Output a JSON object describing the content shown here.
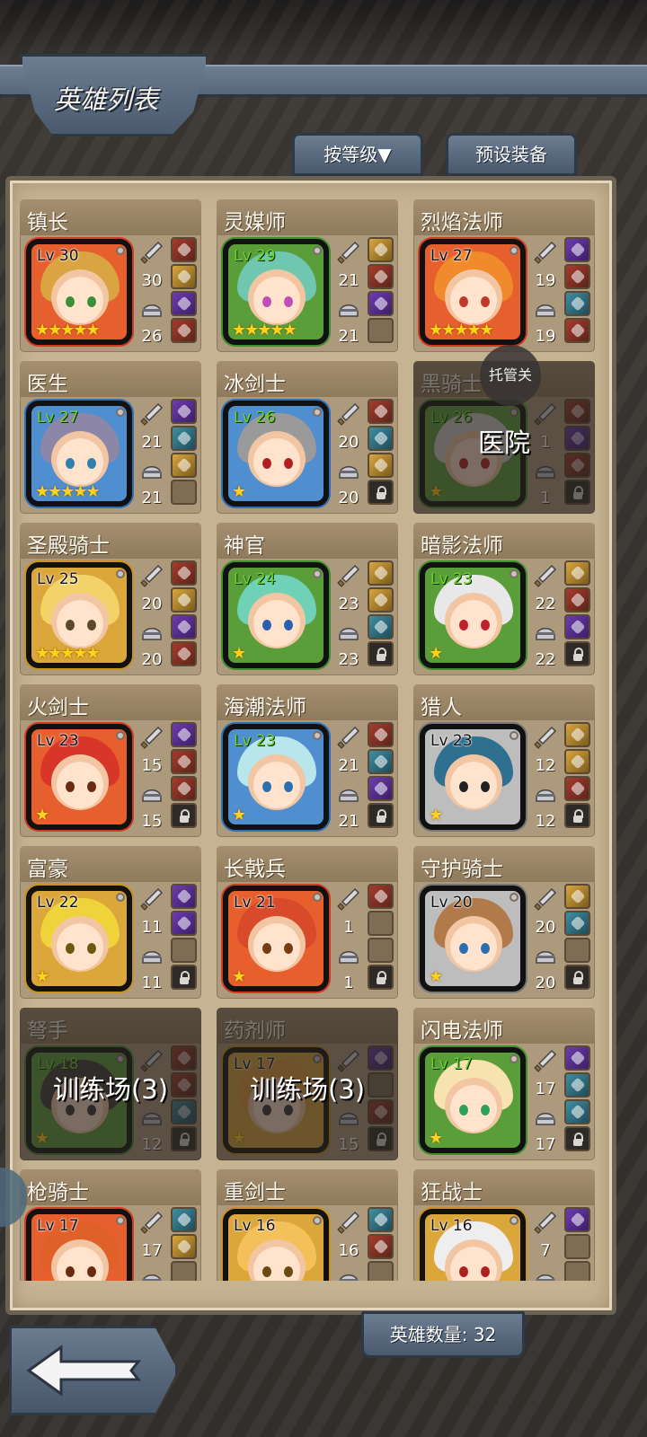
{
  "header": {
    "title": "英雄列表",
    "sort_button": "按等级▼",
    "preset_button": "预设装备"
  },
  "footer": {
    "hero_count_label": "英雄数量: 32"
  },
  "overlay": {
    "tuoguan": "托管关"
  },
  "heroes": [
    {
      "name": "镇长",
      "level": "Lv 30",
      "atk": "30",
      "def": "26",
      "stars": "★★★★★",
      "frame": "red",
      "hair": "#d9a441",
      "eye": "#3a8f3a",
      "slots": [
        "item",
        "item gold",
        "item purple",
        "item"
      ]
    },
    {
      "name": "灵媒师",
      "level": "Lv 29",
      "atk": "21",
      "def": "21",
      "stars": "★★★★★",
      "frame": "green",
      "hair": "#6fc7b0",
      "eye": "#c04fb5",
      "slots": [
        "item gold",
        "item",
        "item purple",
        "empty"
      ]
    },
    {
      "name": "烈焰法师",
      "level": "Lv 27",
      "atk": "19",
      "def": "19",
      "stars": "★★★★★",
      "frame": "red",
      "hair": "#f08a2c",
      "eye": "#c0392b",
      "slots": [
        "item purple",
        "item",
        "item teal",
        "item"
      ]
    },
    {
      "name": "医生",
      "level": "Lv 27",
      "atk": "21",
      "def": "21",
      "stars": "★★★★★",
      "frame": "blue",
      "hair": "#8c86a8",
      "eye": "#2f7fb0",
      "slots": [
        "item purple",
        "item teal",
        "item gold",
        "empty"
      ]
    },
    {
      "name": "冰剑士",
      "level": "Lv 26",
      "atk": "20",
      "def": "20",
      "stars": "★",
      "frame": "blue",
      "hair": "#9a9a9a",
      "eye": "#b02020",
      "slots": [
        "item",
        "item teal",
        "item gold",
        "lock"
      ]
    },
    {
      "name": "黑骑士",
      "level": "Lv 26",
      "atk": "1",
      "def": "1",
      "stars": "★",
      "frame": "green",
      "hair": "#d0d0d0",
      "eye": "#b02020",
      "slots": [
        "item",
        "item purple",
        "item",
        "lock"
      ],
      "overlay": "医院"
    },
    {
      "name": "圣殿骑士",
      "level": "Lv 25",
      "atk": "20",
      "def": "20",
      "stars": "★★★★★",
      "frame": "gold",
      "hair": "#f3d26a",
      "eye": "#5a4a2a",
      "slots": [
        "item",
        "item gold",
        "item purple",
        "item"
      ]
    },
    {
      "name": "神官",
      "level": "Lv 24",
      "atk": "23",
      "def": "23",
      "stars": "★",
      "frame": "green",
      "hair": "#6fd1b5",
      "eye": "#2a5fb0",
      "slots": [
        "item gold",
        "item gold",
        "item teal",
        "lock"
      ]
    },
    {
      "name": "暗影法师",
      "level": "Lv 23",
      "atk": "22",
      "def": "22",
      "stars": "★",
      "frame": "green",
      "hair": "#e8e8e8",
      "eye": "#c0202a",
      "slots": [
        "item gold",
        "item",
        "item purple",
        "lock"
      ]
    },
    {
      "name": "火剑士",
      "level": "Lv 23",
      "atk": "15",
      "def": "15",
      "stars": "★",
      "frame": "red",
      "hair": "#d9362a",
      "eye": "#6b2a10",
      "slots": [
        "item purple",
        "item",
        "item",
        "lock"
      ]
    },
    {
      "name": "海潮法师",
      "level": "Lv 23",
      "atk": "21",
      "def": "21",
      "stars": "★",
      "frame": "blue",
      "hair": "#b9e6ea",
      "eye": "#2a6fb0",
      "slots": [
        "item",
        "item teal",
        "item purple",
        "lock"
      ]
    },
    {
      "name": "猎人",
      "level": "Lv 23",
      "atk": "12",
      "def": "12",
      "stars": "★",
      "frame": "gray",
      "hair": "#2f6f8f",
      "eye": "#222222",
      "slots": [
        "item gold",
        "item gold",
        "item",
        "lock"
      ]
    },
    {
      "name": "富豪",
      "level": "Lv 22",
      "atk": "11",
      "def": "11",
      "stars": "★",
      "frame": "gold",
      "hair": "#f0d33a",
      "eye": "#6b5a10",
      "slots": [
        "item purple",
        "item purple",
        "empty",
        "lock"
      ]
    },
    {
      "name": "长戟兵",
      "level": "Lv 21",
      "atk": "1",
      "def": "1",
      "stars": "★",
      "frame": "red",
      "hair": "#d94a2a",
      "eye": "#7a3a10",
      "slots": [
        "item",
        "empty",
        "empty",
        "lock"
      ]
    },
    {
      "name": "守护骑士",
      "level": "Lv 20",
      "atk": "20",
      "def": "20",
      "stars": "★",
      "frame": "gray",
      "hair": "#b07a4a",
      "eye": "#2a6fb0",
      "slots": [
        "item gold",
        "item teal",
        "empty",
        "lock"
      ]
    },
    {
      "name": "弩手",
      "level": "Lv 18",
      "atk": "",
      "def": "12",
      "stars": "★",
      "frame": "green",
      "hair": "#3a3a3a",
      "eye": "#333333",
      "slots": [
        "item",
        "item",
        "item teal",
        "lock"
      ],
      "overlay": "训练场(3)"
    },
    {
      "name": "药剂师",
      "level": "Lv 17",
      "atk": "",
      "def": "15",
      "stars": "★",
      "frame": "gold",
      "hair": "#e09a3a",
      "eye": "#333333",
      "slots": [
        "item purple",
        "empty",
        "item",
        "lock"
      ],
      "overlay": "训练场(3)"
    },
    {
      "name": "闪电法师",
      "level": "Lv 17",
      "atk": "17",
      "def": "17",
      "stars": "★",
      "frame": "green",
      "hair": "#f6e3b0",
      "eye": "#2fa05a",
      "slots": [
        "item purple",
        "item teal",
        "item teal",
        "lock"
      ]
    },
    {
      "name": "枪骑士",
      "level": "Lv 17",
      "atk": "17",
      "def": "",
      "stars": "",
      "frame": "red",
      "hair": "#e0602a",
      "eye": "#6b2a10",
      "slots": [
        "item teal",
        "item gold",
        "empty",
        "empty"
      ]
    },
    {
      "name": "重剑士",
      "level": "Lv 16",
      "atk": "16",
      "def": "",
      "stars": "",
      "frame": "gold",
      "hair": "#f3c05a",
      "eye": "#6b4a10",
      "slots": [
        "item teal",
        "item",
        "empty",
        "empty"
      ]
    },
    {
      "name": "狂战士",
      "level": "Lv 16",
      "atk": "7",
      "def": "",
      "stars": "",
      "frame": "gold",
      "hair": "#eeeeee",
      "eye": "#b02020",
      "slots": [
        "item purple",
        "empty",
        "empty",
        "empty"
      ]
    }
  ]
}
